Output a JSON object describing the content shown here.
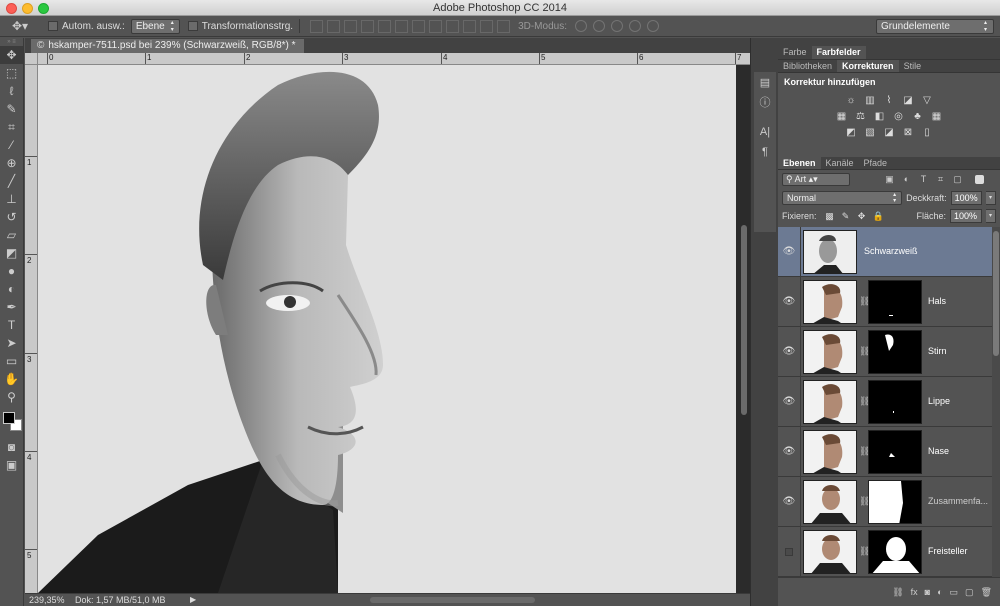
{
  "window": {
    "title": "Adobe Photoshop CC 2014"
  },
  "options_bar": {
    "auto_select_label": "Autom. ausw.:",
    "auto_select_value": "Ebene",
    "transform_label": "Transformationsstrg.",
    "mode3d_label": "3D-Modus:",
    "workspace": "Grundelemente"
  },
  "document": {
    "tab_title": "hskamper-7511.psd bei 239% (Schwarzweiß, RGB/8*) *",
    "tab_close": "©"
  },
  "rulers": {
    "top": [
      "0",
      "1",
      "2",
      "3",
      "4",
      "5",
      "6",
      "7"
    ],
    "left": [
      "1",
      "2",
      "3",
      "4",
      "5"
    ]
  },
  "status": {
    "zoom": "239,35%",
    "doc": "Dok: 1,57 MB/51,0 MB"
  },
  "panels": {
    "top_tabs": [
      "Farbe",
      "Farbfelder"
    ],
    "mid_tabs": [
      "Bibliotheken",
      "Korrekturen",
      "Stile"
    ],
    "adjustments_title": "Korrektur hinzufügen",
    "layer_tabs": [
      "Ebenen",
      "Kanäle",
      "Pfade"
    ],
    "kind_filter": "Art",
    "blend_mode": "Normal",
    "opacity_label": "Deckkraft:",
    "opacity_value": "100%",
    "lock_label": "Fixieren:",
    "fill_label": "Fläche:",
    "fill_value": "100%"
  },
  "layers": [
    {
      "name": "Schwarzweiß",
      "visible": true,
      "selected": true,
      "has_mask": false
    },
    {
      "name": "Hals",
      "visible": true,
      "selected": false,
      "has_mask": true
    },
    {
      "name": "Stirn",
      "visible": true,
      "selected": false,
      "has_mask": true
    },
    {
      "name": "Lippe",
      "visible": true,
      "selected": false,
      "has_mask": true
    },
    {
      "name": "Nase",
      "visible": true,
      "selected": false,
      "has_mask": true
    },
    {
      "name": "Zusammenfa...",
      "visible": true,
      "selected": false,
      "has_mask": true
    },
    {
      "name": "Freisteller",
      "visible": false,
      "selected": false,
      "has_mask": true
    }
  ]
}
